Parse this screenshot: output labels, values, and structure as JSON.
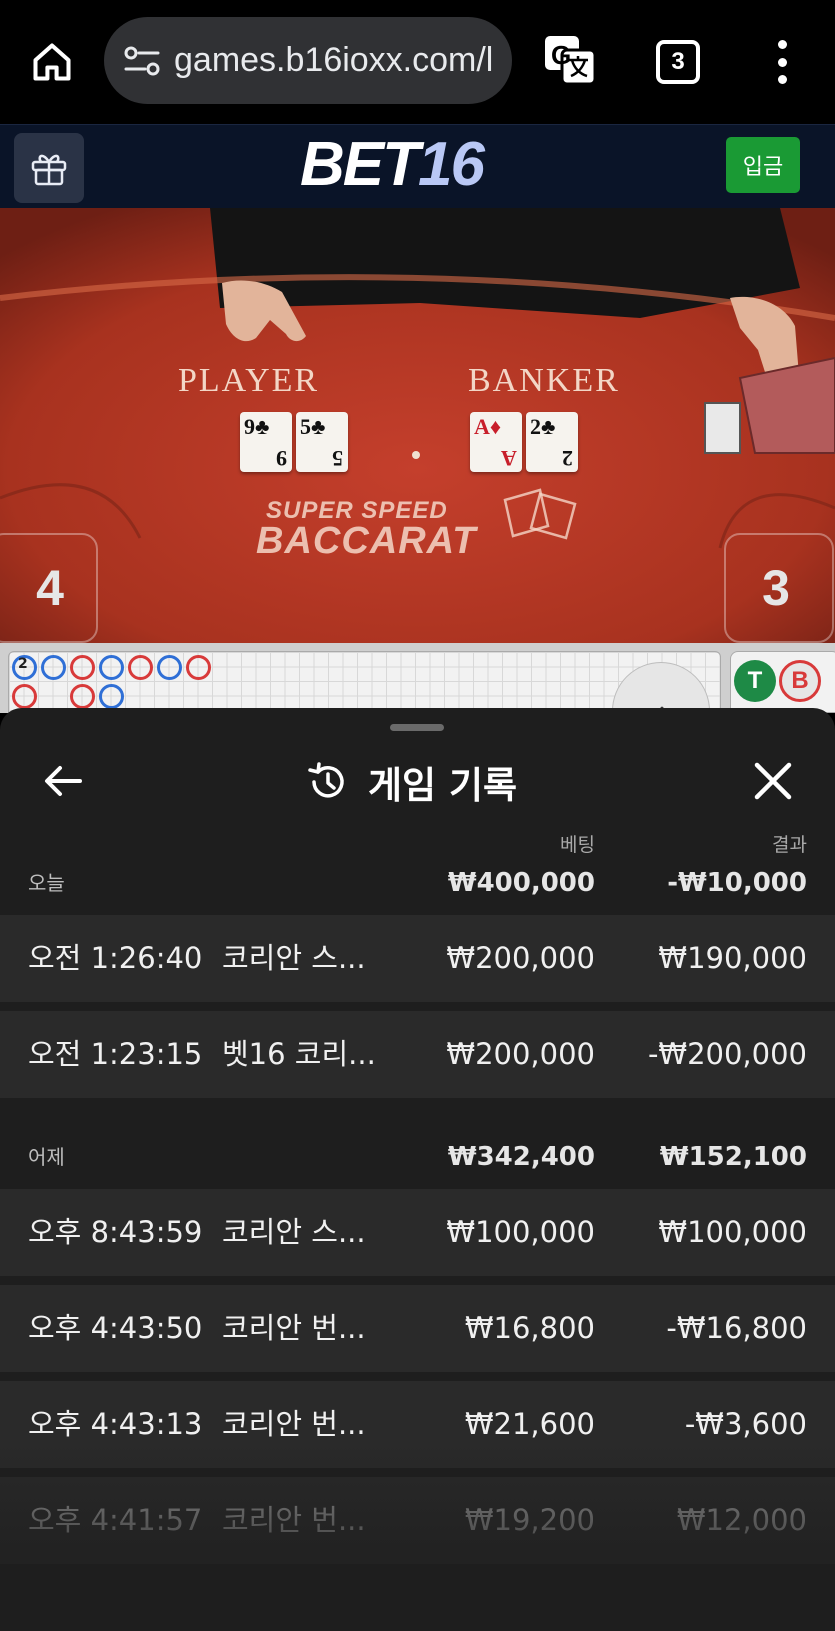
{
  "browser": {
    "url": "games.b16ioxx.com/l",
    "tab_count": "3",
    "icons": [
      "home-icon",
      "site-info-icon",
      "translate-icon",
      "tabs-icon",
      "more-vert-icon"
    ]
  },
  "site_header": {
    "logo_prefix": "BET",
    "logo_number": "16",
    "deposit_label": "입금",
    "icons": [
      "gift-icon"
    ]
  },
  "game": {
    "player_label": "PLAYER",
    "banker_label": "BANKER",
    "title_line1": "SUPER SPEED",
    "title_line2": "BACCARAT",
    "player_score": "4",
    "banker_score": "3",
    "player_cards": [
      {
        "rank": "9",
        "suit": "♣",
        "color": "black"
      },
      {
        "rank": "5",
        "suit": "♣",
        "color": "black"
      }
    ],
    "banker_cards": [
      {
        "rank": "A",
        "suit": "♦",
        "color": "red"
      },
      {
        "rank": "2",
        "suit": "♣",
        "color": "black"
      }
    ]
  },
  "roadmap": {
    "first_bead_mark": "2",
    "tie_label": "T",
    "banker_label": "B"
  },
  "history": {
    "title": "게임 기록",
    "col_bet": "베팅",
    "col_result": "결과",
    "days": [
      {
        "label": "오늘",
        "bet_total": "₩400,000",
        "result_total": "-₩10,000",
        "records": [
          {
            "time": "오전 1:26:40",
            "game": "코리안 스...",
            "bet": "₩200,000",
            "result": "₩190,000"
          },
          {
            "time": "오전 1:23:15",
            "game": "벳16 코리...",
            "bet": "₩200,000",
            "result": "-₩200,000"
          }
        ]
      },
      {
        "label": "어제",
        "bet_total": "₩342,400",
        "result_total": "₩152,100",
        "records": [
          {
            "time": "오후 8:43:59",
            "game": "코리안 스...",
            "bet": "₩100,000",
            "result": "₩100,000"
          },
          {
            "time": "오후 4:43:50",
            "game": "코리안 번...",
            "bet": "₩16,800",
            "result": "-₩16,800"
          },
          {
            "time": "오후 4:43:13",
            "game": "코리안 번...",
            "bet": "₩21,600",
            "result": "-₩3,600"
          },
          {
            "time": "오후 4:41:57",
            "game": "코리안 번...",
            "bet": "₩19,200",
            "result": "₩12,000"
          }
        ]
      }
    ]
  },
  "colors": {
    "sheet_bg": "#1e1e1e",
    "row_bg": "#2a2a2a",
    "deposit_green": "#1a9a34",
    "header_navy": "#0a1428",
    "table_red": "#8a2a1e"
  }
}
